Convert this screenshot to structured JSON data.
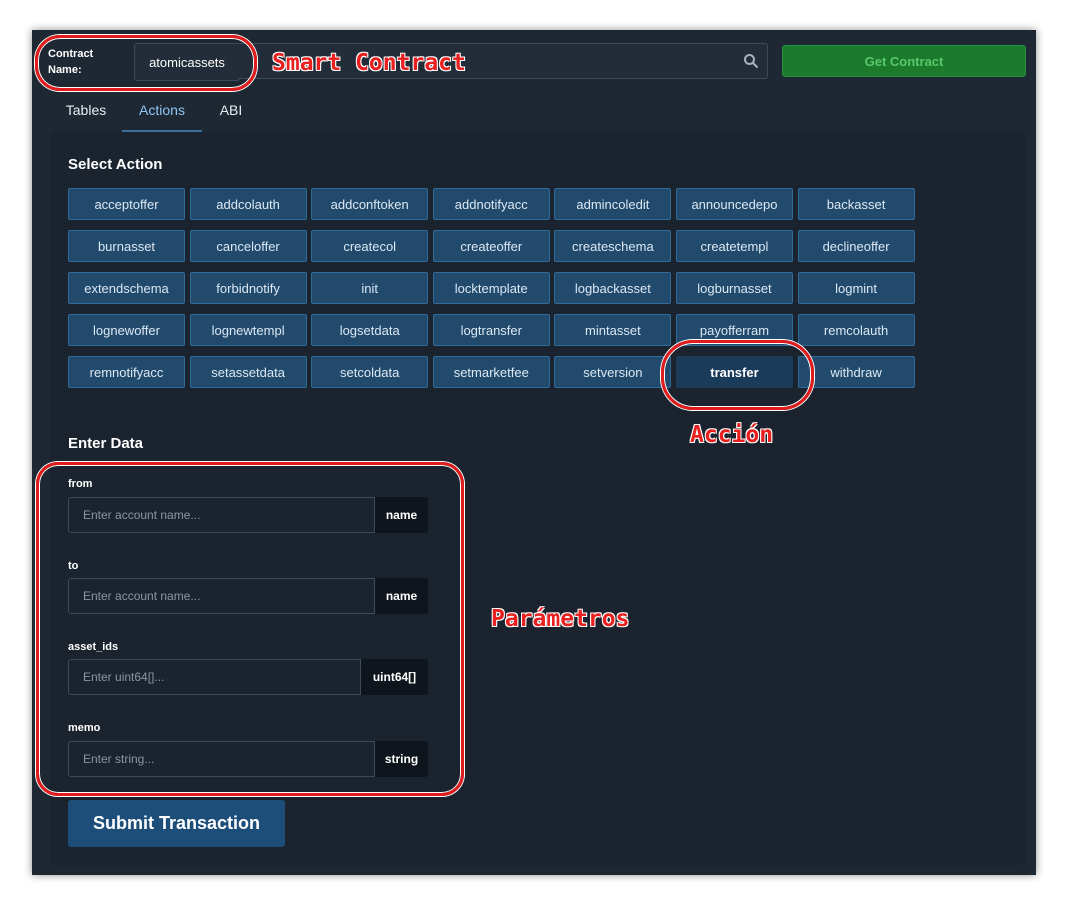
{
  "header": {
    "contract_label": "Contract Name:",
    "contract_value": "atomicassets",
    "get_contract_label": "Get Contract"
  },
  "tabs": [
    {
      "label": "Tables",
      "active": false
    },
    {
      "label": "Actions",
      "active": true
    },
    {
      "label": "ABI",
      "active": false
    }
  ],
  "select_action": {
    "title": "Select Action",
    "selected": "transfer",
    "actions": [
      "acceptoffer",
      "addcolauth",
      "addconftoken",
      "addnotifyacc",
      "admincoledit",
      "announcedepo",
      "backasset",
      "burnasset",
      "canceloffer",
      "createcol",
      "createoffer",
      "createschema",
      "createtempl",
      "declineoffer",
      "extendschema",
      "forbidnotify",
      "init",
      "locktemplate",
      "logbackasset",
      "logburnasset",
      "logmint",
      "lognewoffer",
      "lognewtempl",
      "logsetdata",
      "logtransfer",
      "mintasset",
      "payofferram",
      "remcolauth",
      "remnotifyacc",
      "setassetdata",
      "setcoldata",
      "setmarketfee",
      "setversion",
      "transfer",
      "withdraw"
    ]
  },
  "enter_data": {
    "title": "Enter Data",
    "fields": [
      {
        "label": "from",
        "placeholder": "Enter account name...",
        "type": "name"
      },
      {
        "label": "to",
        "placeholder": "Enter account name...",
        "type": "name"
      },
      {
        "label": "asset_ids",
        "placeholder": "Enter uint64[]...",
        "type": "uint64[]"
      },
      {
        "label": "memo",
        "placeholder": "Enter string...",
        "type": "string"
      }
    ]
  },
  "submit_label": "Submit Transaction",
  "annotations": {
    "smart_contract": "Smart Contract",
    "accion": "Acción",
    "parametros": "Parámetros",
    "color": "#e01c1c"
  },
  "colors": {
    "background": "#1e2833",
    "action_button": "#214a6d",
    "get_contract": "#1b7a2b",
    "submit": "#1d4e7a"
  }
}
